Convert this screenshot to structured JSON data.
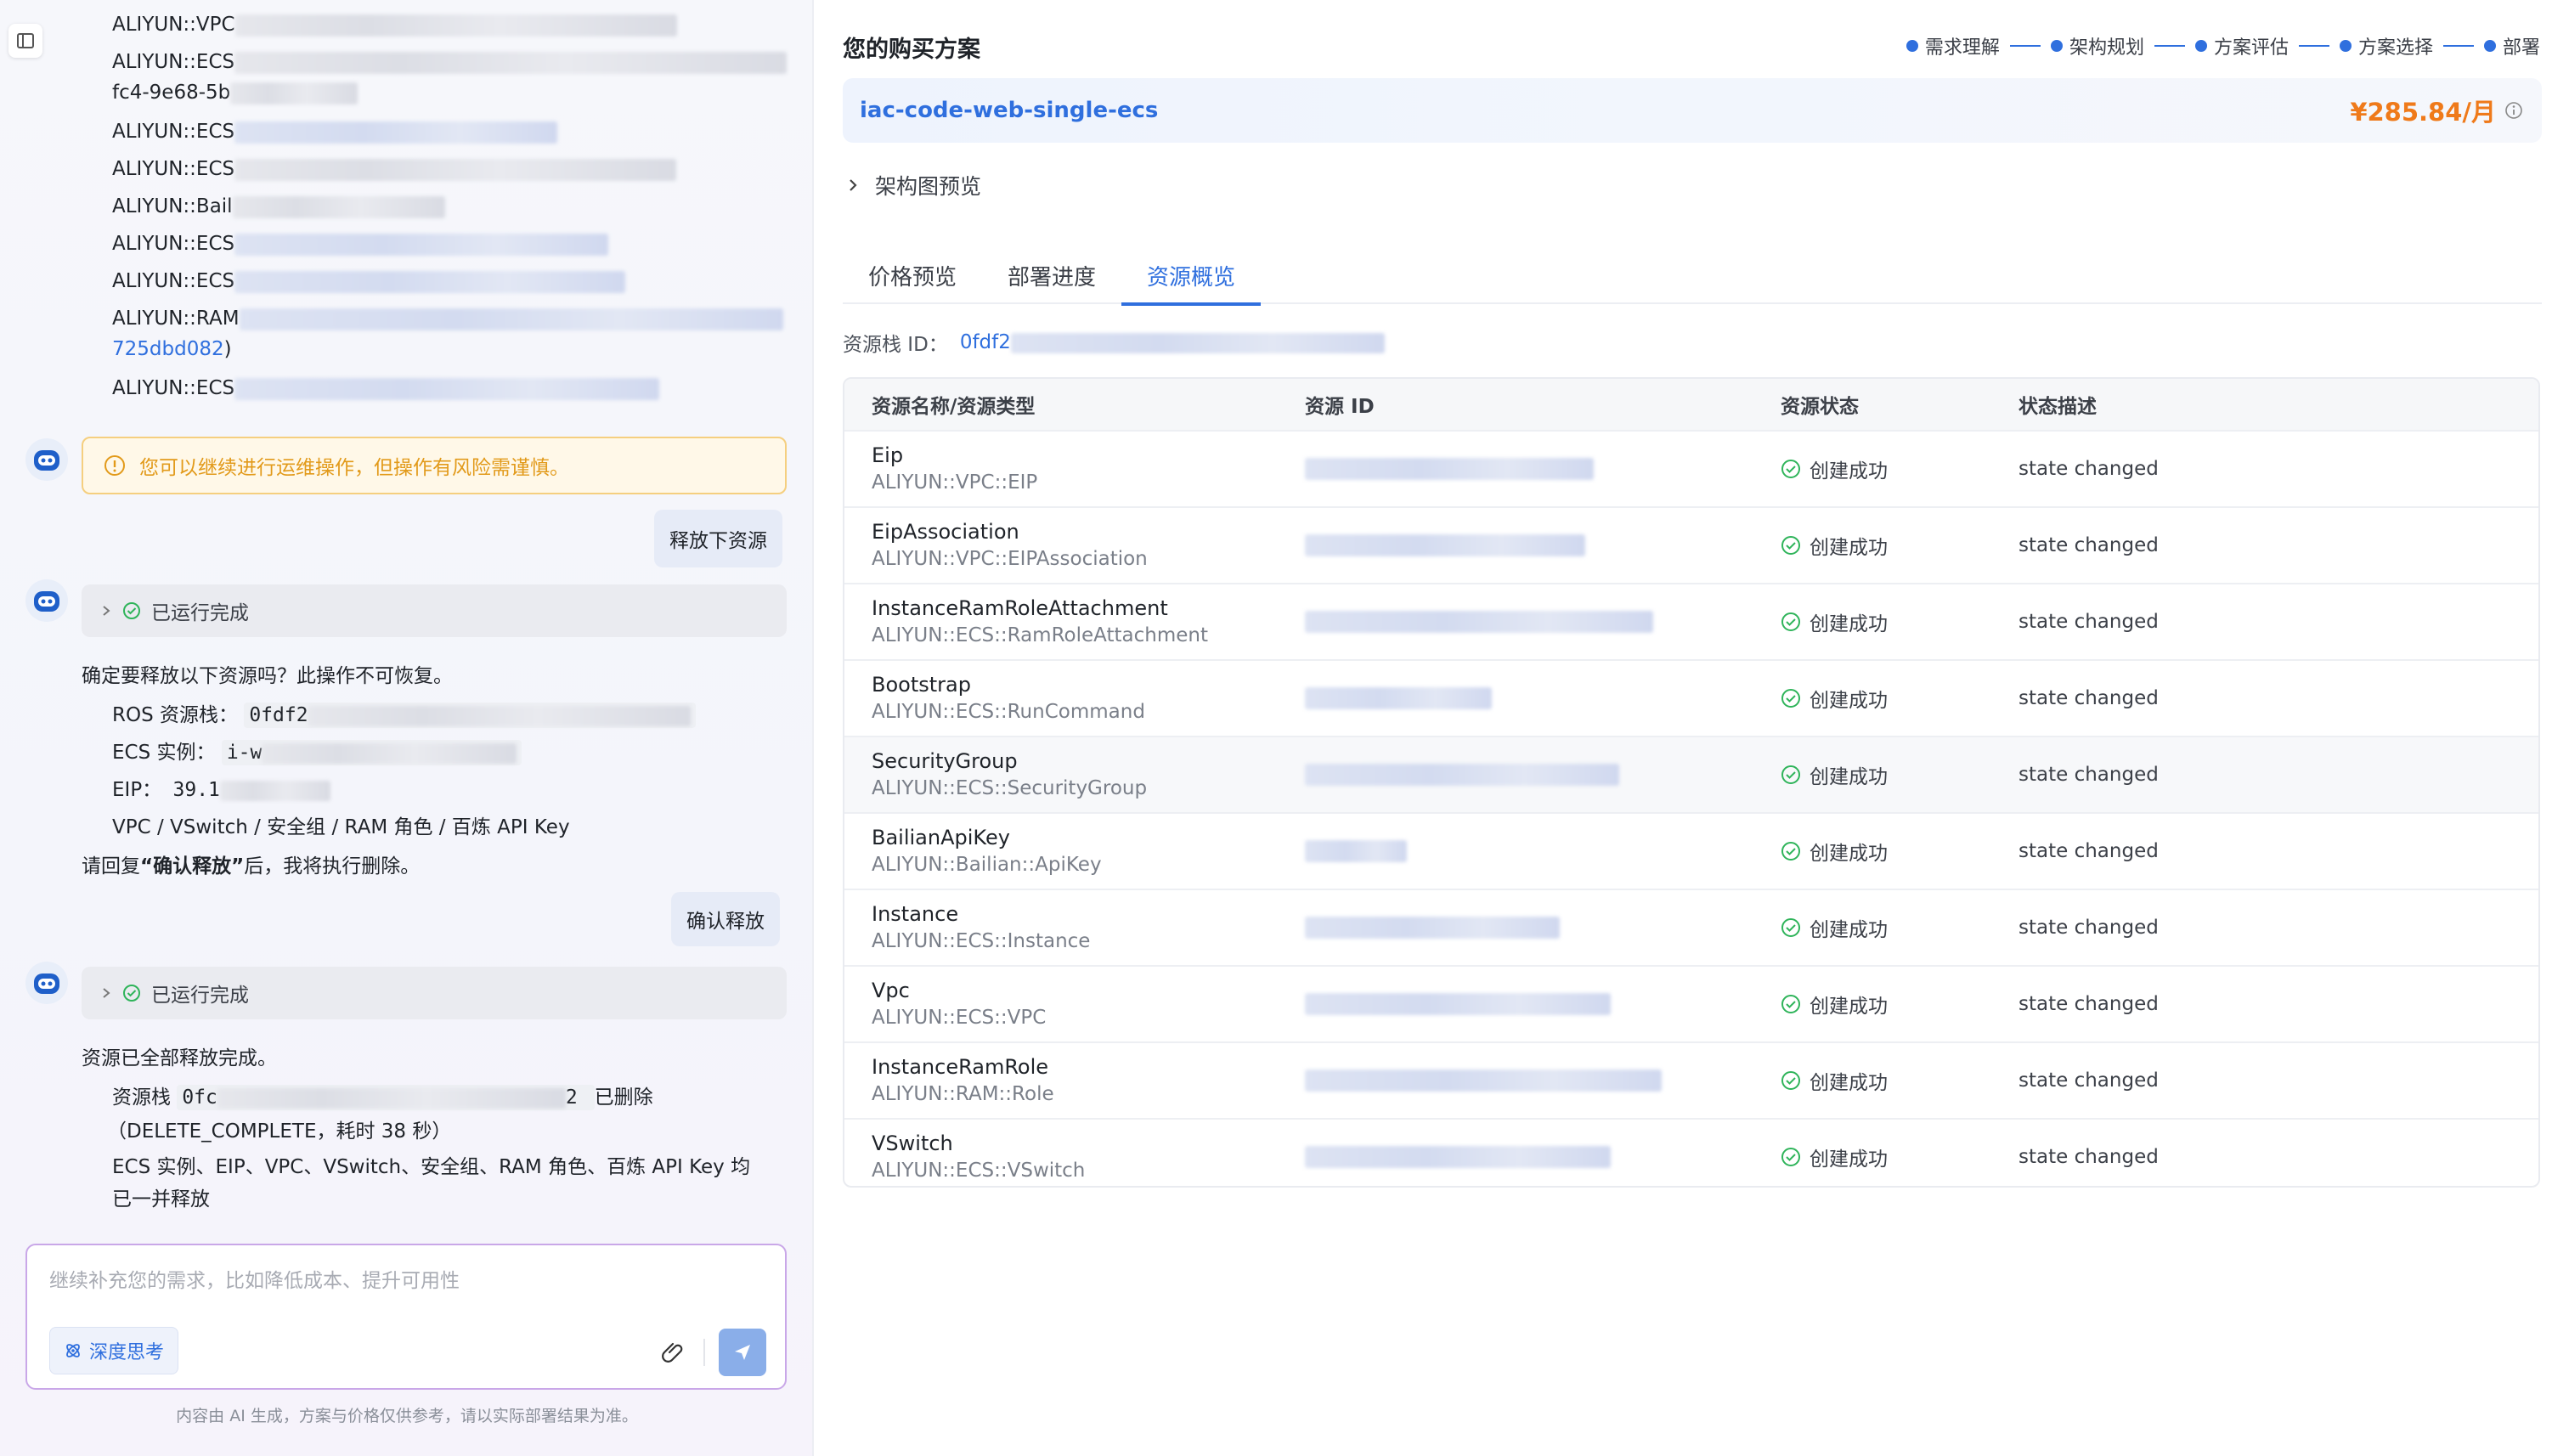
{
  "left": {
    "resource_lines": [
      {
        "label": "ALIYUN::VPC",
        "blur_w": 520,
        "blue": false
      },
      {
        "label": "ALIYUN::ECS",
        "blur_w": 650,
        "blue": false,
        "sub": "fc4-9e68-5b",
        "sub_link": false
      },
      {
        "label": "ALIYUN::ECS",
        "blur_w": 380,
        "blue": true
      },
      {
        "label": "ALIYUN::ECS",
        "blur_w": 520,
        "blue": false
      },
      {
        "label": "ALIYUN::Bail",
        "blur_w": 250,
        "blue": false
      },
      {
        "label": "ALIYUN::ECS",
        "blur_w": 440,
        "blue": true
      },
      {
        "label": "ALIYUN::ECS",
        "blur_w": 460,
        "blue": true
      },
      {
        "label": "ALIYUN::RAM",
        "blur_w": 640,
        "blue": true,
        "sub": "725dbd082",
        "sub_link": true,
        "sub_suffix": ")"
      },
      {
        "label": "ALIYUN::ECS",
        "blur_w": 500,
        "blue": true
      }
    ],
    "warning": "您可以继续进行运维操作，但操作有风险需谨慎。",
    "user_msg_1": "释放下资源",
    "run_done_1": "已运行完成",
    "confirm_text": "确定要释放以下资源吗？此操作不可恢复。",
    "ros_label": "ROS 资源栈：",
    "ros_val": "0fdf2",
    "ecs_label": "ECS 实例：",
    "ecs_val": "i-w",
    "eip_label": "EIP：",
    "eip_val": "39.1",
    "others": "VPC / VSwitch / 安全组 / RAM 角色 / 百炼 API Key",
    "reply_prefix": "请回复",
    "reply_bold": "“确认释放”",
    "reply_suffix": "后，我将执行删除。",
    "user_msg_2": "确认释放",
    "run_done_2": "已运行完成",
    "done_text": "资源已全部释放完成。",
    "stack_label": "资源栈",
    "stack_val_start": "0fc",
    "stack_val_end": "2",
    "stack_deleted": "已删除",
    "stack_detail": "（DELETE_COMPLETE，耗时 38 秒）",
    "released_1": "ECS 实例、EIP、VPC、VSwitch、安全组、RAM 角色、百炼 API Key 均",
    "released_2": "已一并释放",
    "input_placeholder": "继续补充您的需求，比如降低成本、提升可用性",
    "deep_think": "深度思考",
    "disclaimer": "内容由 AI 生成，方案与价格仅供参考，请以实际部署结果为准。"
  },
  "right": {
    "title": "您的购买方案",
    "steps": [
      "需求理解",
      "架构规划",
      "方案评估",
      "方案选择",
      "部署"
    ],
    "plan_name": "iac-code-web-single-ecs",
    "price": "¥285.84/月",
    "arch_preview": "架构图预览",
    "tabs": [
      "价格预览",
      "部署进度",
      "资源概览"
    ],
    "active_tab": 2,
    "stack_id_label": "资源栈 ID：",
    "stack_id_val": "0fdf2",
    "table_headers": [
      "资源名称/资源类型",
      "资源 ID",
      "资源状态",
      "状态描述"
    ],
    "rows": [
      {
        "name": "Eip",
        "type": "ALIYUN::VPC::EIP",
        "status": "创建成功",
        "desc": "state changed",
        "id_w": 340
      },
      {
        "name": "EipAssociation",
        "type": "ALIYUN::VPC::EIPAssociation",
        "status": "创建成功",
        "desc": "state changed",
        "id_w": 330
      },
      {
        "name": "InstanceRamRoleAttachment",
        "type": "ALIYUN::ECS::RamRoleAttachment",
        "status": "创建成功",
        "desc": "state changed",
        "id_w": 410
      },
      {
        "name": "Bootstrap",
        "type": "ALIYUN::ECS::RunCommand",
        "status": "创建成功",
        "desc": "state changed",
        "id_w": 220
      },
      {
        "name": "SecurityGroup",
        "type": "ALIYUN::ECS::SecurityGroup",
        "status": "创建成功",
        "desc": "state changed",
        "id_w": 370
      },
      {
        "name": "BailianApiKey",
        "type": "ALIYUN::Bailian::ApiKey",
        "status": "创建成功",
        "desc": "state changed",
        "id_w": 120
      },
      {
        "name": "Instance",
        "type": "ALIYUN::ECS::Instance",
        "status": "创建成功",
        "desc": "state changed",
        "id_w": 300
      },
      {
        "name": "Vpc",
        "type": "ALIYUN::ECS::VPC",
        "status": "创建成功",
        "desc": "state changed",
        "id_w": 360
      },
      {
        "name": "InstanceRamRole",
        "type": "ALIYUN::RAM::Role",
        "status": "创建成功",
        "desc": "state changed",
        "id_w": 420
      },
      {
        "name": "VSwitch",
        "type": "ALIYUN::ECS::VSwitch",
        "status": "创建成功",
        "desc": "state changed",
        "id_w": 360
      }
    ]
  },
  "colors": {
    "accent": "#2f6fde",
    "price": "#ef7a1a",
    "success": "#2fb45a",
    "warning": "#e29a1a"
  }
}
